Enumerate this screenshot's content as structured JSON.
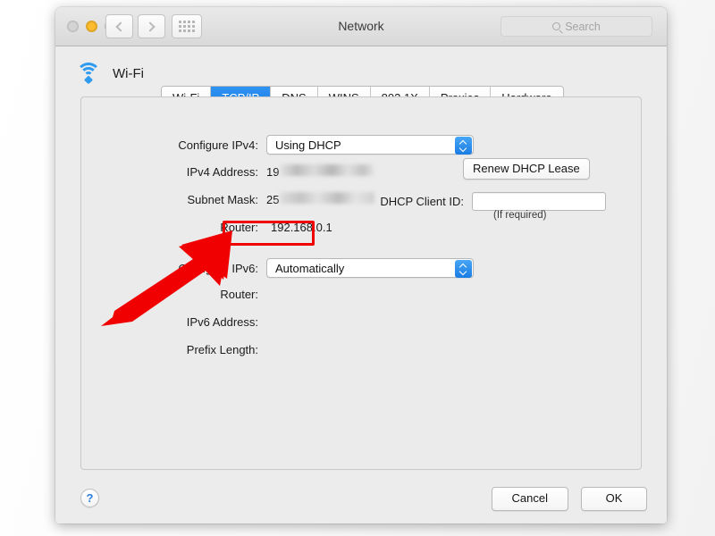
{
  "window": {
    "title": "Network",
    "traffic_lights": [
      {
        "name": "close",
        "state": "disabled"
      },
      {
        "name": "minimize",
        "state": "enabled"
      },
      {
        "name": "zoom",
        "state": "disabled"
      }
    ],
    "nav": {
      "back_icon": "chevron-left-icon",
      "forward_icon": "chevron-right-icon",
      "grid_icon": "show-all-grid-icon"
    }
  },
  "search": {
    "placeholder": "Search",
    "value": "",
    "icon": "search-icon"
  },
  "service": {
    "name": "Wi-Fi",
    "icon": "wifi-icon"
  },
  "tabs": [
    {
      "label": "Wi-Fi",
      "active": false
    },
    {
      "label": "TCP/IP",
      "active": true
    },
    {
      "label": "DNS",
      "active": false
    },
    {
      "label": "WINS",
      "active": false
    },
    {
      "label": "802.1X",
      "active": false
    },
    {
      "label": "Proxies",
      "active": false
    },
    {
      "label": "Hardware",
      "active": false
    }
  ],
  "ipv4": {
    "configure_label": "Configure IPv4:",
    "configure_value": "Using DHCP",
    "address_label": "IPv4 Address:",
    "address_value": "19",
    "address_redacted": true,
    "subnet_label": "Subnet Mask:",
    "subnet_value": "25",
    "subnet_redacted": true,
    "router_label": "Router:",
    "router_value": "192.168.0.1",
    "renew_button": "Renew DHCP Lease",
    "client_id_label": "DHCP Client ID:",
    "client_id_value": "",
    "client_id_hint": "(If required)"
  },
  "ipv6": {
    "configure_label": "Configure IPv6:",
    "configure_value": "Automatically",
    "router_label": "Router:",
    "router_value": "",
    "address_label": "IPv6 Address:",
    "address_value": "",
    "prefix_label": "Prefix Length:",
    "prefix_value": ""
  },
  "footer": {
    "help_label": "?",
    "cancel_label": "Cancel",
    "ok_label": "OK"
  },
  "annotations": {
    "highlight_color": "#f00000",
    "highlight_target": "192.168.0.1",
    "arrow_color": "#f00000",
    "arrow_direction": "up-right"
  }
}
